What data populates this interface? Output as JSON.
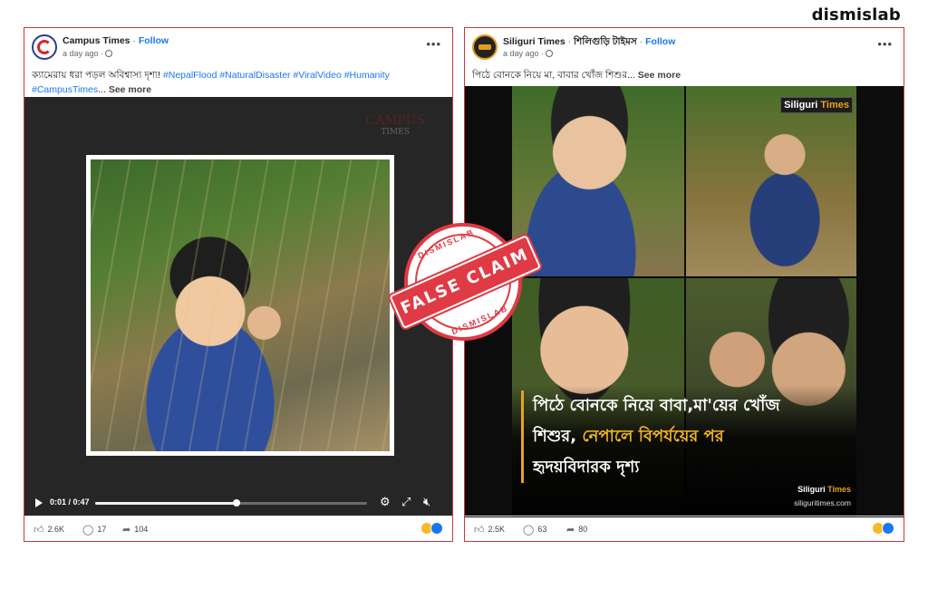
{
  "brand": "dismislab",
  "left_post": {
    "page_name": "Campus Times",
    "separator": " · ",
    "follow": "Follow",
    "time": "a day ago ·",
    "caption_text": "ক্যামেরায় ধরা পড়ল অবিশ্বাস্য দৃশ্য!",
    "hashtags": "#NepalFlood #NaturalDisaster #ViralVideo #Humanity",
    "hashtags_2": "#CampusTimes",
    "ellipsis": "...",
    "see_more": "See more",
    "watermark_line1": "CAMPUS",
    "watermark_line2": "TIMES",
    "video_time": "0:01 / 0:47",
    "video_progress": 0.52,
    "likes": "2.6K",
    "comments": "17",
    "shares": "104"
  },
  "right_post": {
    "page_name": "Siliguri Times",
    "separator": " · ",
    "page_name_bn": "শিলিগুড়ি টাইমস",
    "follow": "Follow",
    "time": "a day ago ·",
    "caption_text": "পিঠে বোনকে নিয়ে মা, বাবার খোঁজ শিশুর",
    "ellipsis": "...",
    "see_more": "See more",
    "logo_a": "Siliguri",
    "logo_b": "Times",
    "overlay_line1": "পিঠে বোনকে নিয়ে বাবা,মা'য়ের খোঁজ",
    "overlay_line2_white": "শিশুর,",
    "overlay_line2_yellow": "নেপালে বিপর্যয়ের পর",
    "overlay_line3": "হৃদয়বিদারক দৃশ্য",
    "site": "siliguritimes.com",
    "likes": "2.5K",
    "comments": "63",
    "shares": "80"
  },
  "stamp": {
    "top": "DISMISLAB",
    "label": "FALSE CLAIM",
    "bottom": "DISMISLAB",
    "color": "#e03a44"
  },
  "icons": {
    "like": "thumbs-up-icon",
    "comment": "comment-icon",
    "share": "share-icon",
    "play": "play-icon",
    "settings": "gear-icon",
    "fullscreen": "fullscreen-icon",
    "volume": "mute-icon"
  },
  "colors": {
    "link": "#1877f2",
    "border": "#c9373f",
    "accent": "#e8a321"
  }
}
